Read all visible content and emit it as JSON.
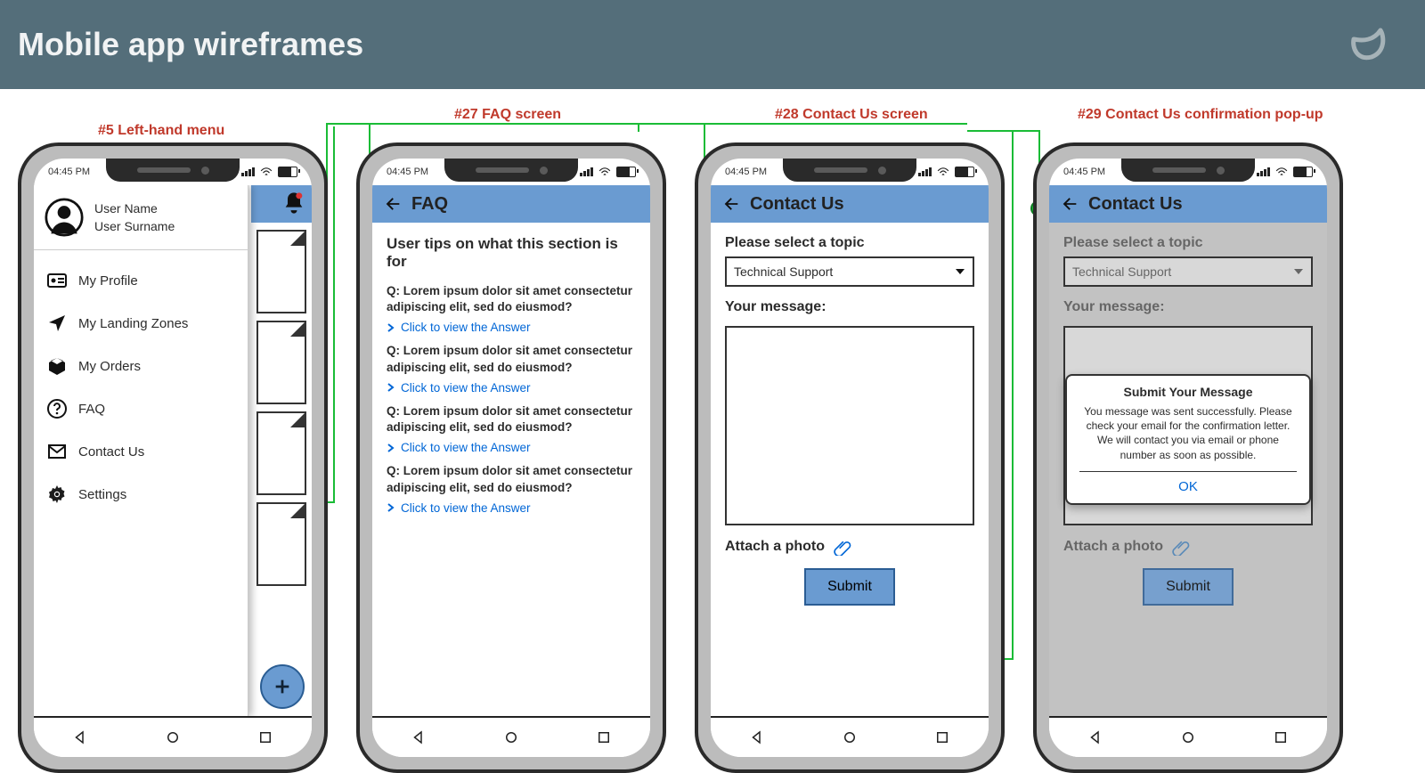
{
  "page": {
    "title": "Mobile app wireframes",
    "clock": "04:45 PM"
  },
  "colors": {
    "banner": "#546e7a",
    "appbar": "#6a9bd1",
    "link": "#0066d6",
    "caption": "#c0392b",
    "arrow": "#1abc36"
  },
  "captions": {
    "s5": "#5 Left-hand menu",
    "s27": "#27 FAQ screen",
    "s28": "#28 Contact Us screen",
    "s29": "#29 Contact Us confirmation pop-up"
  },
  "menu": {
    "user_name": "User Name",
    "user_surname": "User Surname",
    "items": [
      {
        "icon": "id-card-icon",
        "label": "My Profile"
      },
      {
        "icon": "location-icon",
        "label": "My Landing Zones"
      },
      {
        "icon": "box-icon",
        "label": "My Orders"
      },
      {
        "icon": "help-icon",
        "label": "FAQ"
      },
      {
        "icon": "mail-icon",
        "label": "Contact Us"
      },
      {
        "icon": "gear-icon",
        "label": "Settings"
      }
    ]
  },
  "faq": {
    "title": "FAQ",
    "heading": "User tips on what this section is for",
    "question": "Q: Lorem ipsum dolor sit amet consectetur adipiscing elit, sed do eiusmod?",
    "answer_link": "Click to view the Answer"
  },
  "contact": {
    "title": "Contact Us",
    "topic_label": "Please select a topic",
    "topic_value": "Technical Support",
    "message_label": "Your message:",
    "attach_label": "Attach a photo",
    "submit": "Submit"
  },
  "popup": {
    "title": "Submit Your Message",
    "body": "You message was sent successfully. Please check your email for the confirmation letter. We will contact you via email or phone number as soon as possible.",
    "ok": "OK"
  }
}
